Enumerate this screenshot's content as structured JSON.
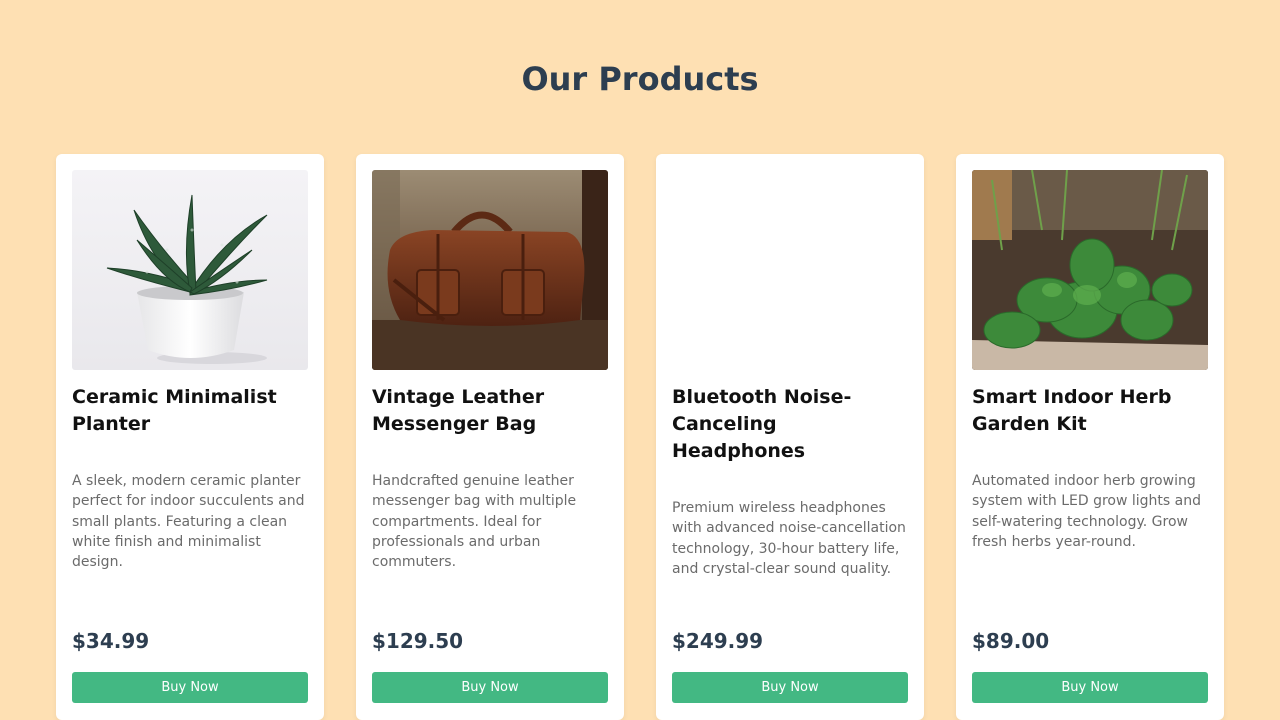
{
  "page": {
    "title": "Our Products"
  },
  "colors": {
    "background": "#fee0b3",
    "title": "#2d3e50",
    "button": "#43b883",
    "price": "#2d3e50"
  },
  "products": [
    {
      "name": "Ceramic Minimalist Planter",
      "description": "A sleek, modern ceramic planter perfect for indoor succulents and small plants. Featuring a clean white finish and minimalist design.",
      "price": "$34.99",
      "button_label": "Buy Now",
      "image": "succulent-in-white-pot-photo"
    },
    {
      "name": "Vintage Leather Messenger Bag",
      "description": "Handcrafted genuine leather messenger bag with multiple compartments. Ideal for professionals and urban commuters.",
      "price": "$129.50",
      "button_label": "Buy Now",
      "image": "leather-duffel-bag-photo"
    },
    {
      "name": "Bluetooth Noise-Canceling Headphones",
      "description": "Premium wireless headphones with advanced noise-cancellation technology, 30-hour battery life, and crystal-clear sound quality.",
      "price": "$249.99",
      "button_label": "Buy Now",
      "image": "blank-image"
    },
    {
      "name": "Smart Indoor Herb Garden Kit",
      "description": "Automated indoor herb growing system with LED grow lights and self-watering technology. Grow fresh herbs year-round.",
      "price": "$89.00",
      "button_label": "Buy Now",
      "image": "herb-garden-bed-photo"
    }
  ]
}
